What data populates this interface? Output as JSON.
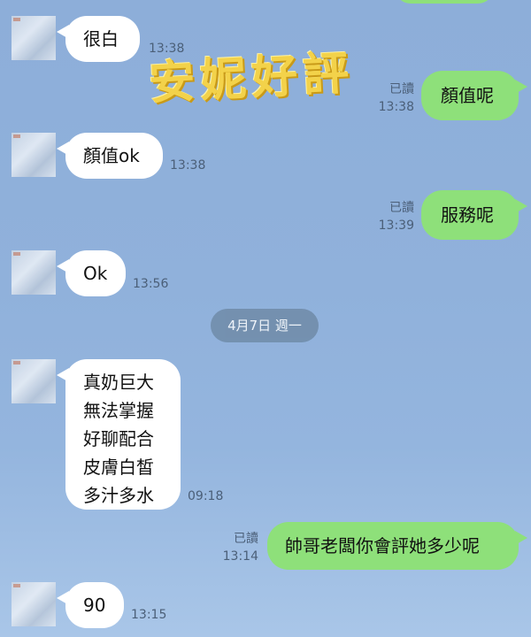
{
  "watermark": "安妮好評",
  "date_separator": "4月7日 週一",
  "messages": [
    {
      "side": "in",
      "text": "很白",
      "time": "13:38"
    },
    {
      "side": "out",
      "text": "顏值呢",
      "read": "已讀",
      "time": "13:38"
    },
    {
      "side": "in",
      "text": "顏值ok",
      "time": "13:38"
    },
    {
      "side": "out",
      "text": "服務呢",
      "read": "已讀",
      "time": "13:39"
    },
    {
      "side": "in",
      "text": "Ok",
      "time": "13:56"
    },
    {
      "side": "in",
      "text": "真奶巨大\n無法掌握\n好聊配合\n皮膚白皙\n多汁多水",
      "time": "09:18"
    },
    {
      "side": "out",
      "text": "帥哥老闆你會評她多少呢",
      "read": "已讀",
      "time": "13:14"
    },
    {
      "side": "in",
      "text": "90",
      "time": "13:15"
    }
  ],
  "colors": {
    "background": "#90b1db",
    "incoming_bubble": "#ffffff",
    "outgoing_bubble": "#8ee07a",
    "date_pill": "#6f8ba8",
    "watermark": "#f3d24a"
  }
}
